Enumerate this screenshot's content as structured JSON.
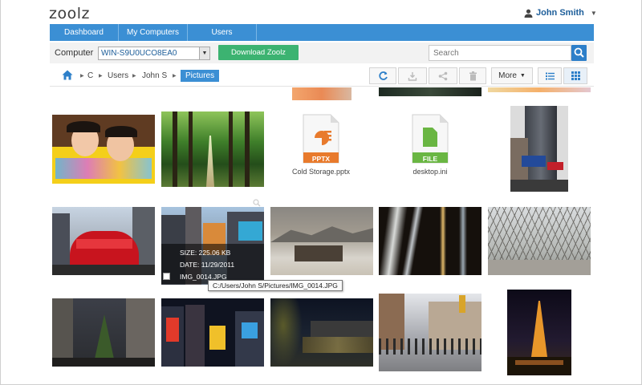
{
  "app": {
    "logo": "zoolz"
  },
  "user": {
    "name": "John Smith"
  },
  "nav": {
    "tabs": [
      "Dashboard",
      "My Computers",
      "Users"
    ]
  },
  "toolbar": {
    "computer_label": "Computer",
    "computer_value": "WIN-S9U0UCO8EA0",
    "download_label": "Download Zoolz",
    "search_placeholder": "Search"
  },
  "breadcrumb": {
    "items": [
      "C",
      "Users",
      "John S"
    ],
    "current": "Pictures"
  },
  "actions": {
    "more_label": "More"
  },
  "files": [
    {
      "name": "Cold Storage.pptx",
      "ext": "PPTX"
    },
    {
      "name": "desktop.ini",
      "ext": "FILE"
    }
  ],
  "hover": {
    "size": "SIZE: 225.06 KB",
    "date": "DATE: 11/29/2011",
    "name": "IMG_0014.JPG",
    "path": "C:/Users/John S/Pictures/IMG_0014.JPG"
  },
  "colors": {
    "accent": "#3b8fd4",
    "download": "#3cb371",
    "pptx": "#e87a2c",
    "file": "#6ab643"
  }
}
